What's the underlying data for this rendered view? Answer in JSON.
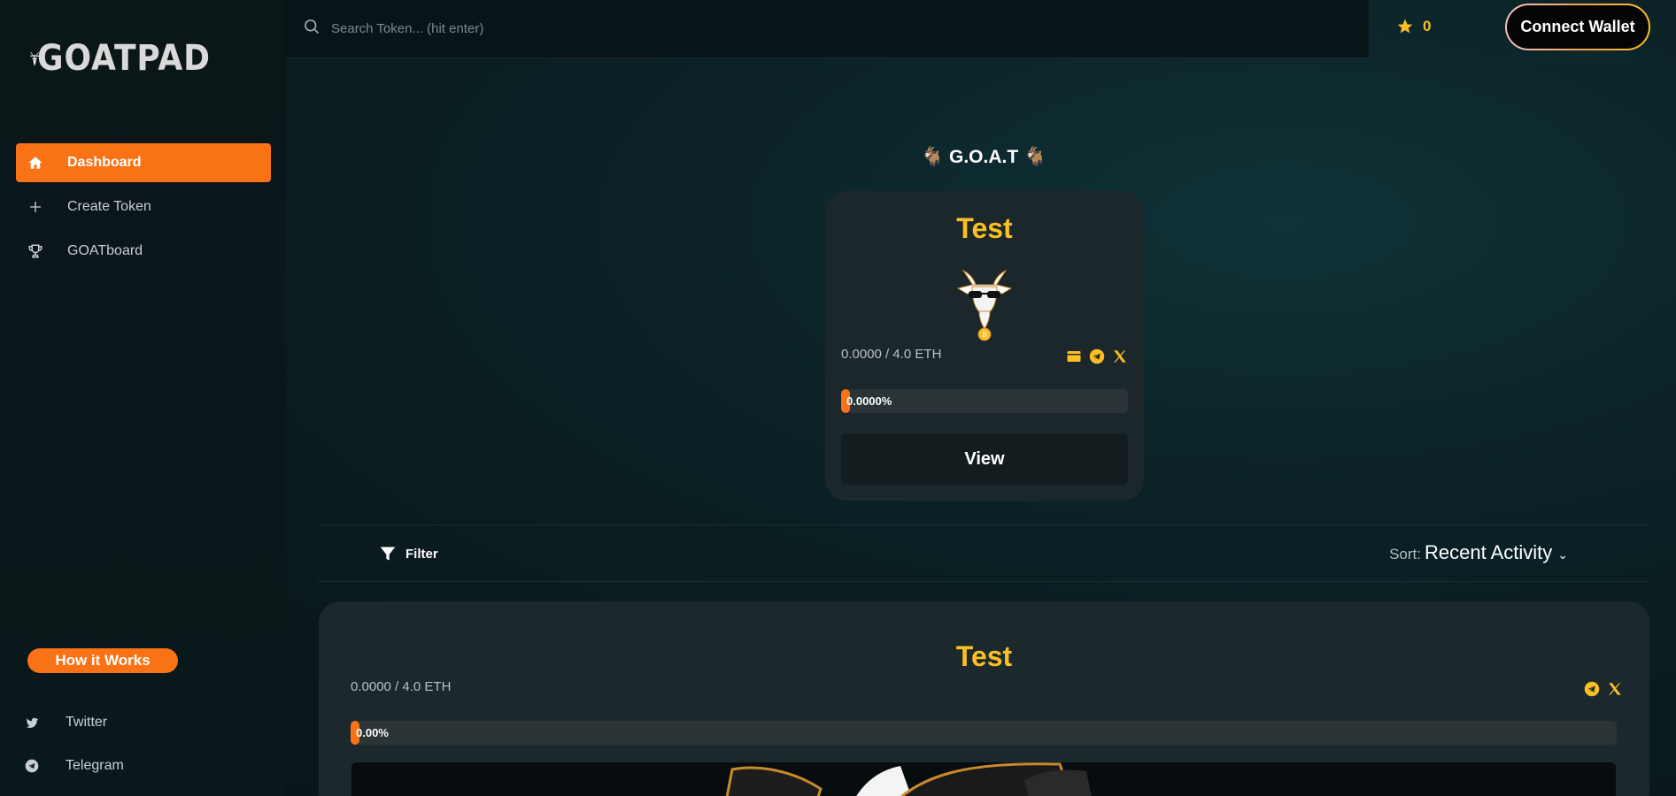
{
  "brand": {
    "name": "GOATPAD"
  },
  "sidebar": {
    "nav": [
      {
        "label": "Dashboard",
        "icon": "home-icon",
        "active": true
      },
      {
        "label": "Create Token",
        "icon": "plus-icon",
        "active": false
      },
      {
        "label": "GOATboard",
        "icon": "trophy-icon",
        "active": false
      }
    ],
    "how_it_works": "How it Works",
    "social": [
      {
        "label": "Twitter",
        "icon": "twitter-icon"
      },
      {
        "label": "Telegram",
        "icon": "telegram-icon"
      }
    ]
  },
  "topbar": {
    "search_placeholder": "Search Token... (hit enter)",
    "favorites_count": "0",
    "connect_wallet": "Connect Wallet"
  },
  "featured": {
    "title": "🐐 G.O.A.T 🐐",
    "token": {
      "name": "Test",
      "raise": "0.0000 / 4.0 ETH",
      "progress_label": "0.0000%",
      "progress": 0,
      "links": [
        "website-icon",
        "telegram-icon",
        "x-icon"
      ],
      "view_label": "View"
    }
  },
  "filterbar": {
    "filter_label": "Filter",
    "sort_label": "Sort:",
    "sort_value": "Recent Activity"
  },
  "token_list": [
    {
      "name": "Test",
      "raise": "0.0000 / 4.0 ETH",
      "progress_label": "0.00%",
      "progress": 0,
      "links": [
        "telegram-icon",
        "x-icon"
      ]
    }
  ],
  "colors": {
    "accent": "#f97316",
    "gold": "#fbbf24",
    "bg": "#0a1a1e",
    "card": "#1b272b"
  }
}
